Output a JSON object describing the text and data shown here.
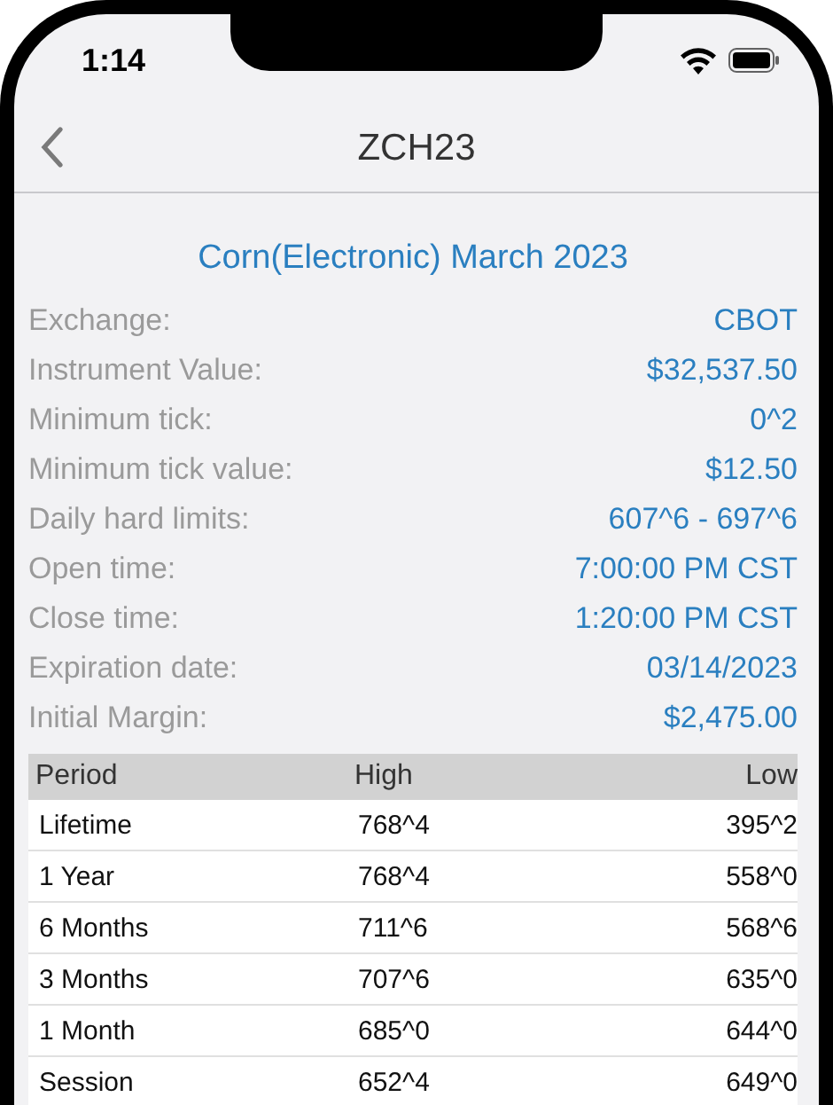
{
  "status_bar": {
    "time": "1:14"
  },
  "nav": {
    "title": "ZCH23"
  },
  "contract": {
    "title": "Corn(Electronic) March 2023",
    "fields": [
      {
        "label": "Exchange:",
        "value": "CBOT"
      },
      {
        "label": "Instrument Value:",
        "value": "$32,537.50"
      },
      {
        "label": "Minimum tick:",
        "value": "0^2"
      },
      {
        "label": "Minimum tick value:",
        "value": "$12.50"
      },
      {
        "label": "Daily hard limits:",
        "value": "607^6 - 697^6"
      },
      {
        "label": "Open time:",
        "value": "7:00:00 PM CST"
      },
      {
        "label": "Close time:",
        "value": "1:20:00 PM CST"
      },
      {
        "label": "Expiration date:",
        "value": "03/14/2023"
      },
      {
        "label": "Initial Margin:",
        "value": "$2,475.00"
      }
    ]
  },
  "table": {
    "columns": [
      "Period",
      "High",
      "Low"
    ],
    "rows": [
      [
        "Lifetime",
        "768^4",
        "395^2"
      ],
      [
        "1 Year",
        "768^4",
        "558^0"
      ],
      [
        "6 Months",
        "711^6",
        "568^6"
      ],
      [
        "3 Months",
        "707^6",
        "635^0"
      ],
      [
        "1 Month",
        "685^0",
        "644^0"
      ],
      [
        "Session",
        "652^4",
        "649^0"
      ]
    ]
  }
}
